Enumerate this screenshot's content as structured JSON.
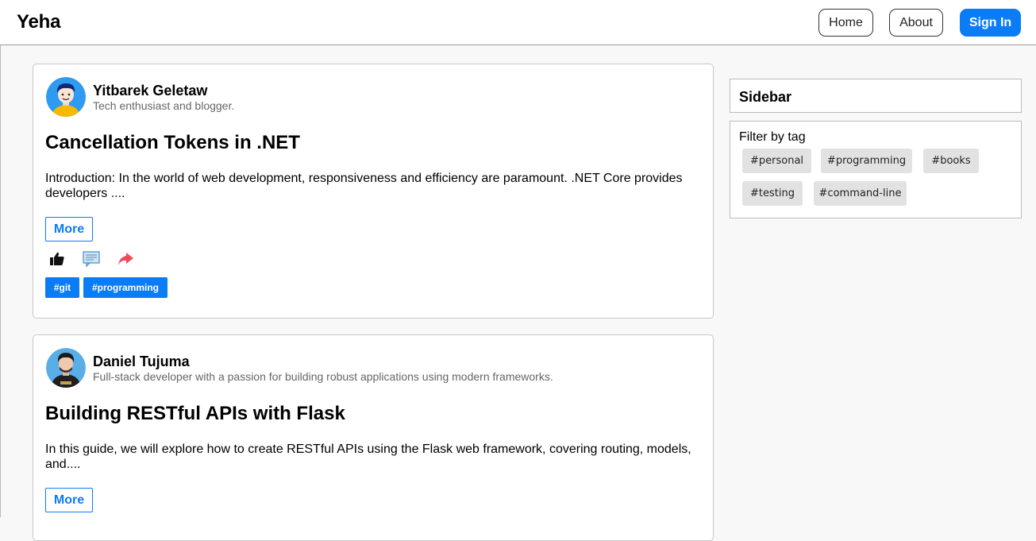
{
  "navbar": {
    "brand": "Yeha",
    "links": {
      "home": "Home",
      "about": "About",
      "signin": "Sign In"
    }
  },
  "posts": [
    {
      "author": "Yitbarek Geletaw",
      "bio": "Tech enthusiast and blogger.",
      "title": "Cancellation Tokens in .NET",
      "excerpt": "Introduction: In the world of web development, responsiveness and efficiency are paramount. .NET Core provides developers ....",
      "more_label": "More",
      "tags": [
        "#git",
        "#programming"
      ]
    },
    {
      "author": "Daniel Tujuma",
      "bio": "Full-stack developer with a passion for building robust applications using modern frameworks.",
      "title": "Building RESTful APIs with Flask",
      "excerpt": "In this guide, we will explore how to create RESTful APIs using the Flask web framework, covering routing, models, and....",
      "more_label": "More"
    }
  ],
  "sidebar": {
    "title": "Sidebar",
    "filter_label": "Filter by tag",
    "tags": [
      "#personal",
      "#programming",
      "#books",
      "#testing",
      "#command-line"
    ]
  },
  "icons": {
    "like": "thumbs-up-icon",
    "comment": "comment-icon",
    "share": "share-icon"
  },
  "colors": {
    "accent": "#0a7cf6",
    "share": "#f04a5a",
    "tag_bg": "#e2e2e2"
  }
}
